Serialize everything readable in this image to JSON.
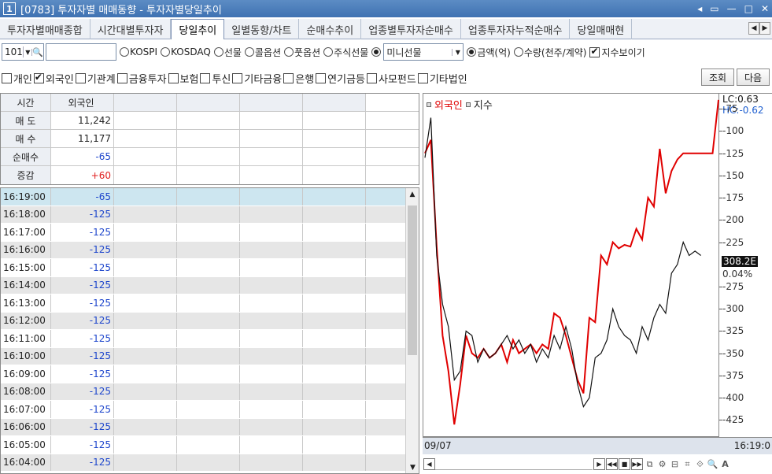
{
  "window": {
    "number": "1",
    "title": "[0783] 투자자별 매매동향 - 투자자별당일추이",
    "buttons": [
      "◂",
      "▭",
      "—",
      "□",
      "✕"
    ]
  },
  "tabs": [
    "투자자별매매종합",
    "시간대별투자자",
    "당일추이",
    "일별동향/차트",
    "순매수추이",
    "업종별투자자순매수",
    "업종투자자누적순매수",
    "당일매매현"
  ],
  "active_tab": 2,
  "toolbar": {
    "code": "101",
    "name_value": "",
    "markets": [
      {
        "label": "KOSPI",
        "selected": false
      },
      {
        "label": "KOSDAQ",
        "selected": false
      },
      {
        "label": "선물",
        "selected": false
      },
      {
        "label": "콜옵션",
        "selected": false
      },
      {
        "label": "풋옵션",
        "selected": false
      },
      {
        "label": "주식선물",
        "selected": false
      },
      {
        "label": "",
        "selected": true
      }
    ],
    "product_select": "미니선물",
    "units": [
      {
        "label": "금액(억)",
        "selected": true
      },
      {
        "label": "수량(천주/계약)",
        "selected": false
      }
    ],
    "show_index_label": "지수보이기",
    "show_index_checked": true
  },
  "filters": [
    {
      "label": "개인",
      "checked": false
    },
    {
      "label": "외국인",
      "checked": true
    },
    {
      "label": "기관계",
      "checked": false
    },
    {
      "label": "금융투자",
      "checked": false
    },
    {
      "label": "보험",
      "checked": false
    },
    {
      "label": "투신",
      "checked": false
    },
    {
      "label": "기타금융",
      "checked": false
    },
    {
      "label": "은행",
      "checked": false
    },
    {
      "label": "연기금등",
      "checked": false
    },
    {
      "label": "사모펀드",
      "checked": false
    },
    {
      "label": "기타법인",
      "checked": false
    }
  ],
  "buttons": {
    "query": "조회",
    "next": "다음"
  },
  "summary": {
    "headers": [
      "시간",
      "외국인"
    ],
    "rows": [
      {
        "label": "매 도",
        "value": "11,242",
        "color": "#222222"
      },
      {
        "label": "매 수",
        "value": "11,177",
        "color": "#222222"
      },
      {
        "label": "순매수",
        "value": "-65",
        "color": "#1e46cc"
      },
      {
        "label": "증감",
        "value": "+60",
        "color": "#e02020"
      }
    ]
  },
  "timeseries": [
    {
      "time": "16:19:00",
      "value": "-65"
    },
    {
      "time": "16:18:00",
      "value": "-125"
    },
    {
      "time": "16:17:00",
      "value": "-125"
    },
    {
      "time": "16:16:00",
      "value": "-125"
    },
    {
      "time": "16:15:00",
      "value": "-125"
    },
    {
      "time": "16:14:00",
      "value": "-125"
    },
    {
      "time": "16:13:00",
      "value": "-125"
    },
    {
      "time": "16:12:00",
      "value": "-125"
    },
    {
      "time": "16:11:00",
      "value": "-125"
    },
    {
      "time": "16:10:00",
      "value": "-125"
    },
    {
      "time": "16:09:00",
      "value": "-125"
    },
    {
      "time": "16:08:00",
      "value": "-125"
    },
    {
      "time": "16:07:00",
      "value": "-125"
    },
    {
      "time": "16:06:00",
      "value": "-125"
    },
    {
      "time": "16:05:00",
      "value": "-125"
    },
    {
      "time": "16:04:00",
      "value": "-125"
    }
  ],
  "chart_data": {
    "type": "line",
    "legend": [
      "외국인",
      "지수"
    ],
    "legend_colors": [
      "#e00000",
      "#111111"
    ],
    "lc_label": "LC:0.63",
    "hc_label": "HC:-0.62",
    "y_ticks": [
      "-75",
      "-100",
      "-125",
      "-150",
      "-175",
      "-200",
      "-225",
      "-275",
      "-300",
      "-325",
      "-350",
      "-375",
      "-400",
      "-425"
    ],
    "ylim": [
      -445,
      -58
    ],
    "current_index": "308.2E",
    "current_pct": "0.04%",
    "x_start_label": "09/07",
    "x_end_label": "16:19:0",
    "series": [
      {
        "name": "외국인",
        "color": "#e00000",
        "x": [
          0,
          2,
          4,
          6,
          8,
          10,
          12,
          14,
          16,
          18,
          20,
          22,
          24,
          26,
          28,
          30,
          32,
          34,
          36,
          38,
          40,
          42,
          44,
          46,
          48,
          50,
          52,
          54,
          56,
          58,
          60,
          62,
          64,
          66,
          68,
          70,
          72,
          74,
          76,
          78,
          80,
          82,
          84,
          86,
          88,
          90,
          92,
          94,
          96,
          98,
          100
        ],
        "values": [
          -125,
          -110,
          -230,
          -330,
          -370,
          -430,
          -385,
          -330,
          -350,
          -355,
          -345,
          -355,
          -350,
          -340,
          -360,
          -335,
          -350,
          -345,
          -340,
          -350,
          -340,
          -345,
          -305,
          -310,
          -330,
          -355,
          -380,
          -395,
          -310,
          -315,
          -240,
          -250,
          -225,
          -232,
          -228,
          -230,
          -210,
          -222,
          -175,
          -185,
          -120,
          -170,
          -145,
          -132,
          -125,
          -125,
          -125,
          -125,
          -125,
          -125,
          -65
        ]
      },
      {
        "name": "지수",
        "color": "#111111",
        "x": [
          0,
          2,
          4,
          6,
          8,
          10,
          12,
          14,
          16,
          18,
          20,
          22,
          24,
          26,
          28,
          30,
          32,
          34,
          36,
          38,
          40,
          42,
          44,
          46,
          48,
          50,
          52,
          54,
          56,
          58,
          60,
          62,
          64,
          66,
          68,
          70,
          72,
          74,
          76,
          78,
          80,
          82,
          84,
          86,
          88,
          90,
          92,
          94
        ],
        "values": [
          -130,
          -85,
          -240,
          -295,
          -320,
          -380,
          -370,
          -325,
          -330,
          -360,
          -345,
          -355,
          -350,
          -340,
          -330,
          -345,
          -335,
          -350,
          -340,
          -360,
          -345,
          -355,
          -330,
          -345,
          -320,
          -345,
          -385,
          -410,
          -400,
          -355,
          -350,
          -335,
          -300,
          -320,
          -330,
          -335,
          -350,
          -320,
          -335,
          -310,
          -295,
          -305,
          -260,
          -250,
          -225,
          -240,
          -235,
          -240
        ]
      }
    ]
  },
  "navbar_icons": [
    "▶",
    "◀◀",
    "■",
    "▶▶",
    "⧉",
    "⚙",
    "⊟",
    "⌗",
    "⟐",
    "🔍",
    "A"
  ]
}
